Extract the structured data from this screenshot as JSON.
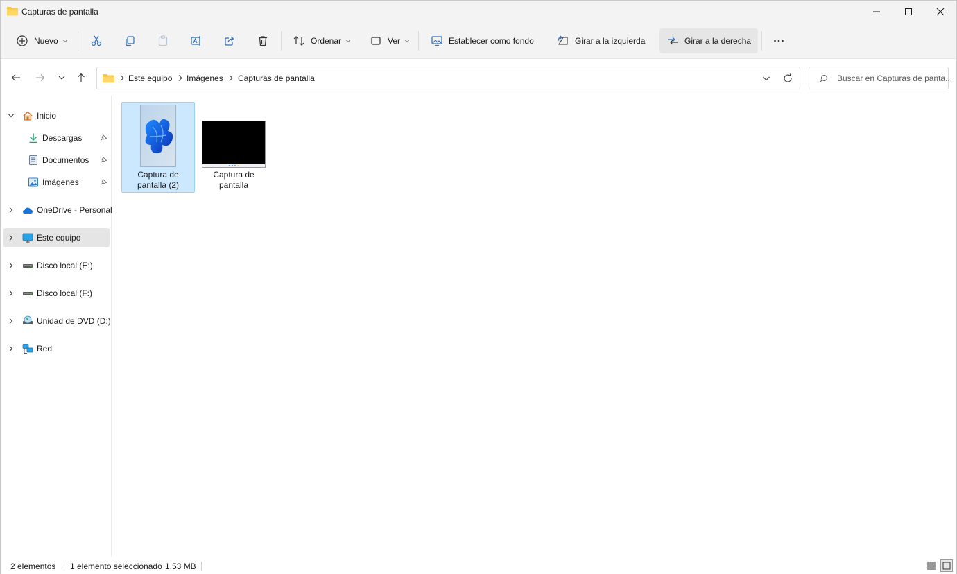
{
  "window": {
    "title": "Capturas de pantalla",
    "icon": "folder-icon",
    "controls": [
      "minimize-icon",
      "maximize-icon",
      "close-icon"
    ]
  },
  "toolbar": {
    "new_label": "Nuevo",
    "sort_label": "Ordenar",
    "view_label": "Ver",
    "set_background_label": "Establecer como fondo",
    "rotate_left_label": "Girar a la izquierda",
    "rotate_right_label": "Girar a la derecha",
    "icons": [
      "cut-icon",
      "copy-icon",
      "paste-icon",
      "rename-icon",
      "share-icon",
      "delete-icon",
      "more-icon"
    ]
  },
  "address": {
    "breadcrumbs": [
      "Este equipo",
      "Imágenes",
      "Capturas de pantalla"
    ]
  },
  "search": {
    "placeholder": "Buscar en Capturas de panta..."
  },
  "sidebar": {
    "items": [
      {
        "label": "Inicio",
        "icon": "home-icon"
      },
      {
        "label": "Descargas",
        "icon": "download-icon",
        "pinned": true
      },
      {
        "label": "Documentos",
        "icon": "document-icon",
        "pinned": true
      },
      {
        "label": "Imágenes",
        "icon": "pictures-icon",
        "pinned": true
      },
      {
        "label": "OneDrive - Personal",
        "icon": "cloud-icon"
      },
      {
        "label": "Este equipo",
        "icon": "computer-icon",
        "selected": true
      },
      {
        "label": "Disco local (E:)",
        "icon": "drive-icon"
      },
      {
        "label": "Disco local (F:)",
        "icon": "drive-icon"
      },
      {
        "label": "Unidad de DVD (D:)",
        "icon": "dvd-icon"
      },
      {
        "label": "Red",
        "icon": "network-icon"
      }
    ]
  },
  "files": [
    {
      "name": "Captura de pantalla (2)",
      "selected": true,
      "thumb": "windows-wallpaper"
    },
    {
      "name": "Captura de pantalla",
      "selected": false,
      "thumb": "black-screen"
    }
  ],
  "status": {
    "count": "2 elementos",
    "selection": "1 elemento seleccionado",
    "size": "1,53 MB"
  },
  "colors": {
    "accent": "#0067c0",
    "selection_bg": "#cce8ff",
    "selection_border": "#99d1ff",
    "folder": "#f8c74a",
    "chrome_bg": "#f3f3f3"
  }
}
